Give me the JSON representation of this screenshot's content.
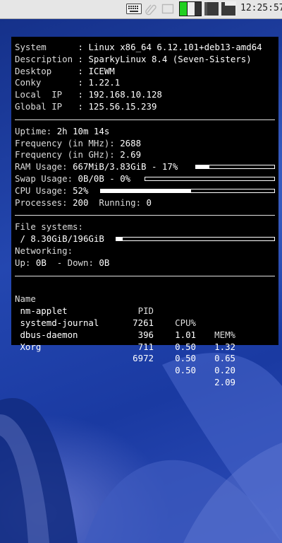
{
  "taskbar": {
    "clock": "12:25:57",
    "icons": [
      "keyboard-icon",
      "clip-icon",
      "window-icon",
      "cpu-graph-icon",
      "memory-graph-icon",
      "network-graph-icon"
    ]
  },
  "conky": {
    "system_info": [
      {
        "label": "System     ",
        "value": "Linux x86_64 6.12.101+deb13-amd64"
      },
      {
        "label": "Description",
        "value": "SparkyLinux 8.4 (Seven-Sisters)"
      },
      {
        "label": "Desktop    ",
        "value": "ICEWM"
      },
      {
        "label": "Conky      ",
        "value": "1.22.1"
      },
      {
        "label": "Local  IP  ",
        "value": "192.168.10.128"
      },
      {
        "label": "Global IP  ",
        "value": "125.56.15.239"
      }
    ],
    "uptime_label": "Uptime:",
    "uptime": "2h 10m 14s",
    "freq_mhz_label": "Frequency (in MHz):",
    "freq_mhz": "2688",
    "freq_ghz_label": "Frequency (in GHz):",
    "freq_ghz": "2.69",
    "ram_label": "RAM Usage:",
    "ram": "667MiB/3.83GiB - 17%",
    "ram_fraction": 0.17,
    "swap_label": "Swap Usage:",
    "swap": "0B/0B - 0%",
    "swap_fraction": 0.0,
    "cpu_label": "CPU Usage:",
    "cpu": "52%",
    "cpu_fraction": 0.52,
    "processes_label": "Processes:",
    "processes": "200",
    "running_label": "Running:",
    "running": "0",
    "fs_label": "File systems:",
    "fs_root": " / 8.30GiB/196GiB",
    "fs_fraction": 0.04,
    "net_label": "Networking:",
    "up_label": "Up:",
    "up": "0B",
    "down_label": "- Down:",
    "down": "0B",
    "table": {
      "headers": {
        "name": "Name",
        "pid": "PID",
        "cpu": "CPU%",
        "mem": "MEM%"
      },
      "rows": [
        {
          "name": " nm-applet",
          "pid": "7261",
          "cpu": "1.01",
          "mem": "1.32"
        },
        {
          "name": " systemd-journal",
          "pid": "396",
          "cpu": "0.50",
          "mem": "0.65"
        },
        {
          "name": " dbus-daemon",
          "pid": "711",
          "cpu": "0.50",
          "mem": "0.20"
        },
        {
          "name": " Xorg",
          "pid": "6972",
          "cpu": "0.50",
          "mem": "2.09"
        }
      ]
    }
  }
}
